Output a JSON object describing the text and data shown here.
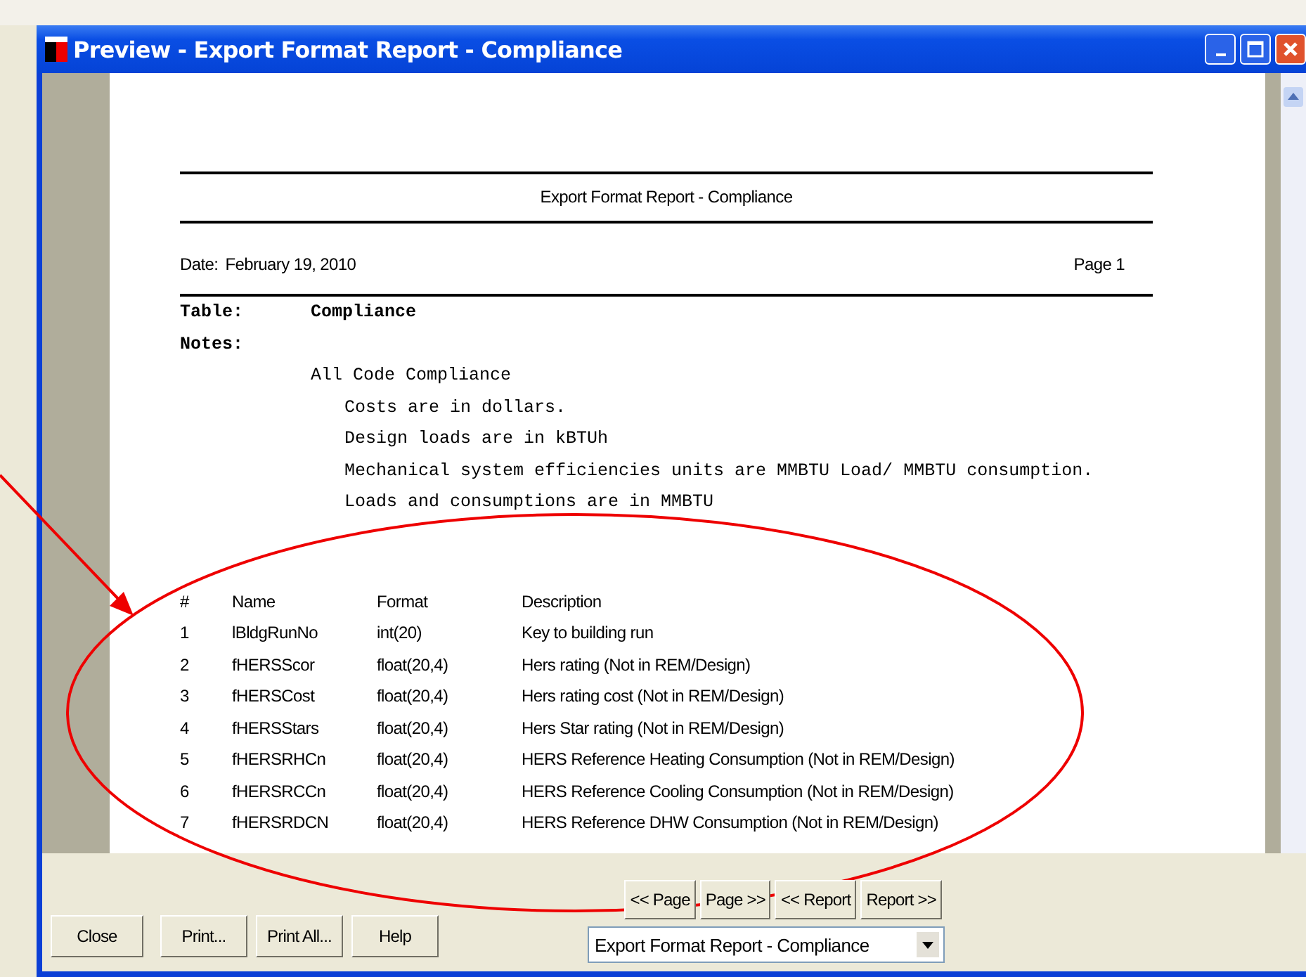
{
  "window": {
    "title": "Preview - Export Format Report - Compliance"
  },
  "report": {
    "header": "Export Format Report - Compliance",
    "date_label": "Date:",
    "date": "February 19, 2010",
    "page": "Page 1",
    "table_label": "Table:",
    "table_name": "Compliance",
    "notes_label": "Notes:",
    "notes": [
      "All Code Compliance",
      "Costs are in dollars.",
      "Design loads are in kBTUh",
      "Mechanical system efficiencies units are MMBTU Load/ MMBTU consumption.",
      "Loads and consumptions are in MMBTU"
    ],
    "columns": [
      "#",
      "Name",
      "Format",
      "Description"
    ],
    "rows": [
      [
        "1",
        "lBldgRunNo",
        "int(20)",
        "Key to building run"
      ],
      [
        "2",
        "fHERSScor",
        "float(20,4)",
        "Hers rating (Not in REM/Design)"
      ],
      [
        "3",
        "fHERSCost",
        "float(20,4)",
        "Hers rating cost (Not in REM/Design)"
      ],
      [
        "4",
        "fHERSStars",
        "float(20,4)",
        "Hers Star rating (Not in REM/Design)"
      ],
      [
        "5",
        "fHERSRHCn",
        "float(20,4)",
        "HERS Reference Heating Consumption (Not in REM/Design)"
      ],
      [
        "6",
        "fHERSRCCn",
        "float(20,4)",
        "HERS Reference Cooling Consumption (Not in REM/Design)"
      ],
      [
        "7",
        "fHERSRDCN",
        "float(20,4)",
        "HERS Reference DHW Consumption (Not in REM/Design)"
      ]
    ]
  },
  "nav_buttons": [
    "<< Page",
    "Page >>",
    "<< Report",
    "Report >>"
  ],
  "report_select": {
    "value": "Export Format Report - Compliance"
  },
  "buttons": [
    "Close",
    "Print...",
    "Print All...",
    "Help"
  ]
}
